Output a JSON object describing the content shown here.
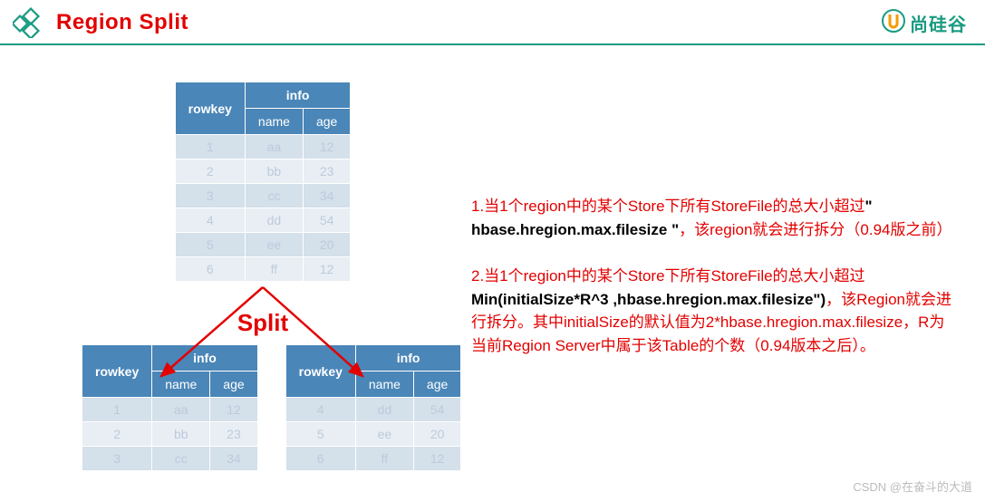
{
  "header": {
    "title": "Region Split",
    "brand_name": "尚硅谷"
  },
  "table_headers": {
    "rowkey": "rowkey",
    "info": "info",
    "name": "name",
    "age": "age"
  },
  "top_table": {
    "rows": [
      {
        "rowkey": "1",
        "name": "aa",
        "age": "12"
      },
      {
        "rowkey": "2",
        "name": "bb",
        "age": "23"
      },
      {
        "rowkey": "3",
        "name": "cc",
        "age": "34"
      },
      {
        "rowkey": "4",
        "name": "dd",
        "age": "54"
      },
      {
        "rowkey": "5",
        "name": "ee",
        "age": "20"
      },
      {
        "rowkey": "6",
        "name": "ff",
        "age": "12"
      }
    ]
  },
  "split_label": "Split",
  "left_table": {
    "rows": [
      {
        "rowkey": "1",
        "name": "aa",
        "age": "12"
      },
      {
        "rowkey": "2",
        "name": "bb",
        "age": "23"
      },
      {
        "rowkey": "3",
        "name": "cc",
        "age": "34"
      }
    ]
  },
  "right_table": {
    "rows": [
      {
        "rowkey": "4",
        "name": "dd",
        "age": "54"
      },
      {
        "rowkey": "5",
        "name": "ee",
        "age": "20"
      },
      {
        "rowkey": "6",
        "name": "ff",
        "age": "12"
      }
    ]
  },
  "rules": {
    "r1_a": "1.当1个region中的某个Store下所有StoreFile的总大小超过",
    "r1_bold": "\" hbase.hregion.max.filesize \"",
    "r1_b": "，该region就会进行拆分（0.94版之前）",
    "r2_a": "2.当1个region中的某个Store下所有StoreFile的总大小超过",
    "r2_bold": "Min(initialSize*R^3 ,hbase.hregion.max.filesize\")",
    "r2_b": "，该Region就会进行拆分。其中initialSize的默认值为2*hbase.hregion.max.filesize，R为当前Region Server中属于该Table的个数（0.94版本之后）。"
  },
  "watermark": "CSDN @在奋斗的大道"
}
